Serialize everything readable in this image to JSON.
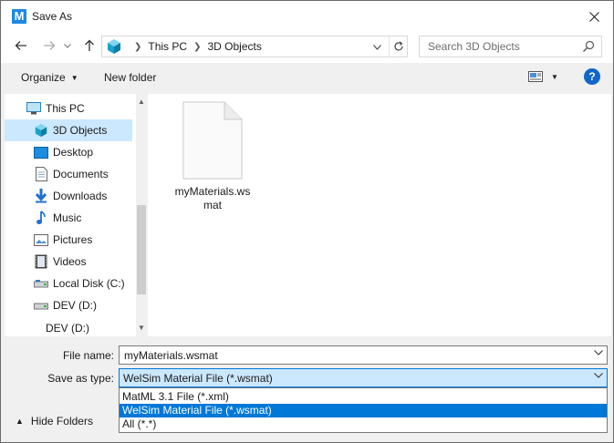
{
  "window": {
    "title": "Save As",
    "app_icon_letter": "M"
  },
  "nav": {
    "breadcrumbs": [
      "This PC",
      "3D Objects"
    ],
    "search_placeholder": "Search 3D Objects"
  },
  "toolbar": {
    "organize_label": "Organize",
    "new_folder_label": "New folder"
  },
  "sidebar": {
    "items": [
      {
        "label": "This PC",
        "icon": "computer-icon"
      },
      {
        "label": "3D Objects",
        "icon": "cube-icon",
        "selected": true
      },
      {
        "label": "Desktop",
        "icon": "desktop-icon"
      },
      {
        "label": "Documents",
        "icon": "documents-icon"
      },
      {
        "label": "Downloads",
        "icon": "download-icon"
      },
      {
        "label": "Music",
        "icon": "music-icon"
      },
      {
        "label": "Pictures",
        "icon": "pictures-icon"
      },
      {
        "label": "Videos",
        "icon": "videos-icon"
      },
      {
        "label": "Local Disk (C:)",
        "icon": "drive-icon"
      },
      {
        "label": "DEV (D:)",
        "icon": "drive-icon"
      },
      {
        "label": "DEV (D:)",
        "icon": "drive-icon"
      }
    ]
  },
  "files": [
    {
      "name": "myMaterials.wsmat",
      "icon": "document-icon"
    }
  ],
  "form": {
    "file_name_label": "File name:",
    "file_name_value": "myMaterials.wsmat",
    "save_type_label": "Save as type:",
    "save_type_value": "WelSim Material File (*.wsmat)",
    "save_type_options": [
      "MatML 3.1 File (*.xml)",
      "WelSim Material File (*.wsmat)",
      "All (*.*)"
    ],
    "hide_folders_label": "Hide Folders"
  },
  "colors": {
    "accent": "#0078d7",
    "selection": "#cce8ff",
    "help": "#1166c8"
  }
}
